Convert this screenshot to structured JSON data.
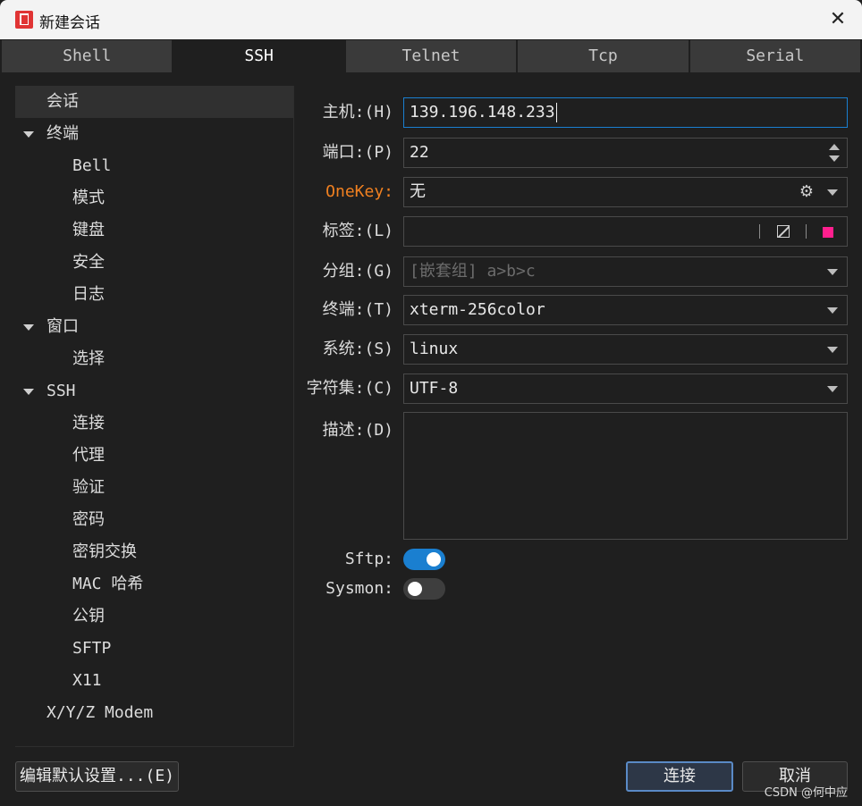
{
  "window": {
    "title": "新建会话",
    "close_glyph": "✕",
    "app_icon": "app-logo-icon"
  },
  "tabs": [
    {
      "label": "Shell",
      "active": false
    },
    {
      "label": "SSH",
      "active": true
    },
    {
      "label": "Telnet",
      "active": false
    },
    {
      "label": "Tcp",
      "active": false
    },
    {
      "label": "Serial",
      "active": false
    }
  ],
  "tree": [
    {
      "label": "会话",
      "level": 0,
      "selected": true
    },
    {
      "label": "终端",
      "level": 0,
      "expanded": true
    },
    {
      "label": "Bell",
      "level": 1
    },
    {
      "label": "模式",
      "level": 1
    },
    {
      "label": "键盘",
      "level": 1
    },
    {
      "label": "安全",
      "level": 1
    },
    {
      "label": "日志",
      "level": 1
    },
    {
      "label": "窗口",
      "level": 0,
      "expanded": true
    },
    {
      "label": "选择",
      "level": 1
    },
    {
      "label": "SSH",
      "level": 0,
      "expanded": true
    },
    {
      "label": "连接",
      "level": 1
    },
    {
      "label": "代理",
      "level": 1
    },
    {
      "label": "验证",
      "level": 1
    },
    {
      "label": "密码",
      "level": 1
    },
    {
      "label": "密钥交换",
      "level": 1
    },
    {
      "label": "MAC 哈希",
      "level": 1
    },
    {
      "label": "公钥",
      "level": 1
    },
    {
      "label": "SFTP",
      "level": 1
    },
    {
      "label": "X11",
      "level": 1
    },
    {
      "label": "X/Y/Z Modem",
      "level": 0
    }
  ],
  "form": {
    "host": {
      "label": "主机:(H)",
      "value": "139.196.148.233"
    },
    "port": {
      "label": "端口:(P)",
      "value": "22"
    },
    "onekey": {
      "label": "OneKey:",
      "value": "无",
      "label_color": "#f08020"
    },
    "tag": {
      "label": "标签:(L)",
      "value": "",
      "color_swatch": "#ff1f8e"
    },
    "group": {
      "label": "分组:(G)",
      "placeholder": "[嵌套组] a>b>c"
    },
    "terminal": {
      "label": "终端:(T)",
      "value": "xterm-256color"
    },
    "system": {
      "label": "系统:(S)",
      "value": "linux"
    },
    "charset": {
      "label": "字符集:(C)",
      "value": "UTF-8"
    },
    "description": {
      "label": "描述:(D)",
      "value": ""
    },
    "sftp": {
      "label": "Sftp:",
      "on": true
    },
    "sysmon": {
      "label": "Sysmon:",
      "on": false
    }
  },
  "buttons": {
    "defaults": "编辑默认设置...(E)",
    "connect": "连接",
    "cancel": "取消"
  },
  "watermark": "CSDN @何中应",
  "colors": {
    "accent": "#1a7fd0",
    "background": "#1f1f1f",
    "tab_inactive": "#3a3a3a"
  }
}
